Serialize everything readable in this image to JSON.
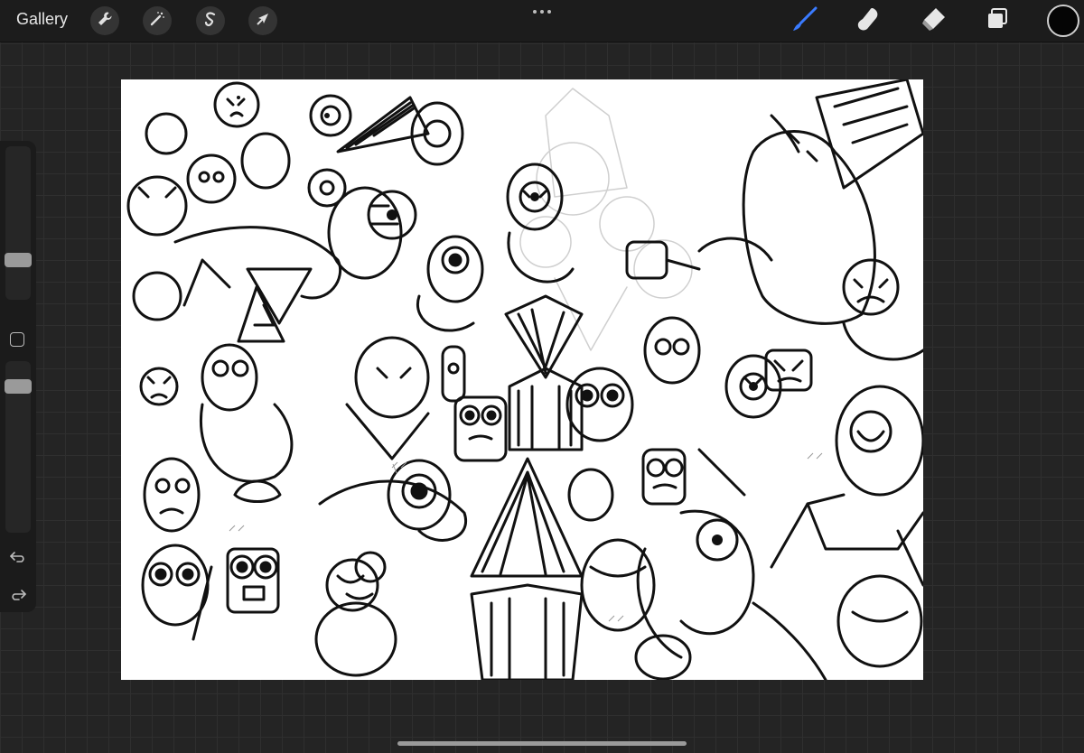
{
  "toolbar": {
    "gallery_label": "Gallery",
    "left_tools": [
      {
        "name": "actions",
        "icon": "wrench-icon"
      },
      {
        "name": "adjustments",
        "icon": "magic-wand-icon"
      },
      {
        "name": "selection",
        "icon": "selection-s-icon"
      },
      {
        "name": "transform",
        "icon": "arrow-cursor-icon"
      }
    ],
    "right_tools": [
      {
        "name": "brush",
        "icon": "brush-icon",
        "active": true,
        "color": "#3a7bff"
      },
      {
        "name": "smudge",
        "icon": "smudge-finger-icon",
        "active": false
      },
      {
        "name": "eraser",
        "icon": "eraser-icon",
        "active": false
      },
      {
        "name": "layers",
        "icon": "layers-icon",
        "active": false
      }
    ],
    "current_color": "#050505",
    "more_icon": "ellipsis-icon"
  },
  "sidebar": {
    "brush_size_slider": "brush-size-slider",
    "opacity_slider": "opacity-slider",
    "modify_button_icon": "square-icon",
    "undo_icon": "undo-icon",
    "redo_icon": "redo-icon"
  },
  "canvas": {
    "background": "#ffffff",
    "content": "line-art-drawing"
  }
}
